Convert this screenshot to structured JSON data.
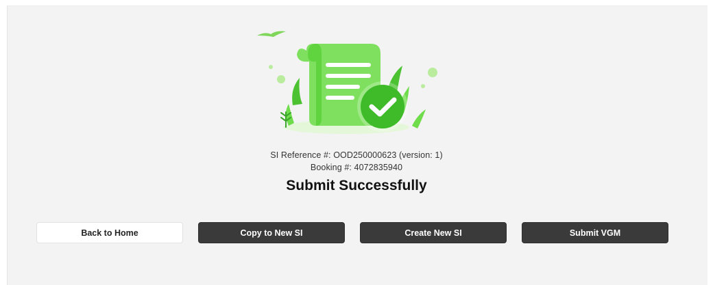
{
  "result": {
    "si_reference_text": "SI Reference #: OOD250000623 (version: 1)",
    "booking_text": "Booking #: 4072835940",
    "title": "Submit Successfully"
  },
  "actions": {
    "back_to_home": "Back to Home",
    "copy_to_new_si": "Copy to New SI",
    "create_new_si": "Create New SI",
    "submit_vgm": "Submit VGM"
  },
  "colors": {
    "green_light": "#8ee06a",
    "green_main": "#5fd43f",
    "green_dark": "#3aa52a",
    "button_dark": "#3a3a3a",
    "panel_bg": "#f3f3f3"
  },
  "icons": {
    "illustration": "document-check-icon"
  }
}
